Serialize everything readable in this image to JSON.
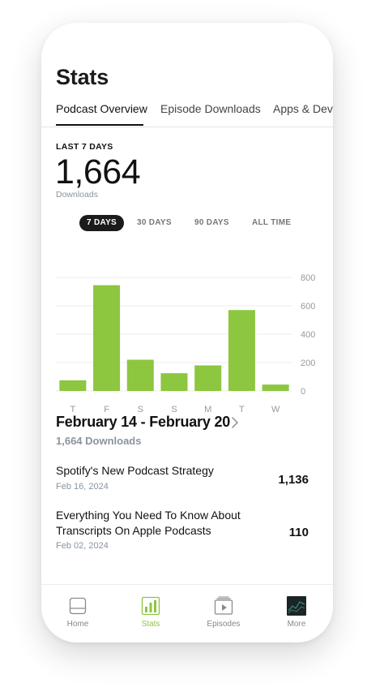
{
  "header": {
    "title": "Stats"
  },
  "tabs": [
    {
      "label": "Podcast Overview",
      "active": true
    },
    {
      "label": "Episode Downloads",
      "active": false
    },
    {
      "label": "Apps & Devi",
      "active": false
    }
  ],
  "summary": {
    "period_label": "LAST 7 DAYS",
    "downloads": "1,664",
    "downloads_label": "Downloads"
  },
  "ranges": [
    {
      "label": "7 DAYS",
      "active": true
    },
    {
      "label": "30 DAYS",
      "active": false
    },
    {
      "label": "90 DAYS",
      "active": false
    },
    {
      "label": "ALL TIME",
      "active": false
    }
  ],
  "chart_data": {
    "type": "bar",
    "categories": [
      "T",
      "F",
      "S",
      "S",
      "M",
      "T",
      "W"
    ],
    "values": [
      75,
      745,
      220,
      125,
      180,
      570,
      45
    ],
    "ylim": [
      0,
      800
    ],
    "yticks": [
      "800",
      "600",
      "400",
      "200",
      "0"
    ],
    "ytick_values": [
      800,
      600,
      400,
      200,
      0
    ],
    "grid": true,
    "bar_color": "#8dc63f"
  },
  "range_detail": {
    "title": "February 14 - February 20",
    "downloads": "1,664 Downloads"
  },
  "episodes": [
    {
      "title": "Spotify's New Podcast Strategy",
      "date": "Feb 16, 2024",
      "downloads": "1,136"
    },
    {
      "title": "Everything You Need To Know About Transcripts On Apple Podcasts",
      "date": "Feb 02, 2024",
      "downloads": "110"
    }
  ],
  "nav": [
    {
      "label": "Home",
      "icon": "home-icon",
      "active": false
    },
    {
      "label": "Stats",
      "icon": "stats-icon",
      "active": true
    },
    {
      "label": "Episodes",
      "icon": "episodes-icon",
      "active": false
    },
    {
      "label": "More",
      "icon": "more-icon",
      "active": false
    }
  ],
  "colors": {
    "accent": "#8dc63f",
    "dark": "#1b1b1b",
    "muted": "#8a94a0"
  }
}
